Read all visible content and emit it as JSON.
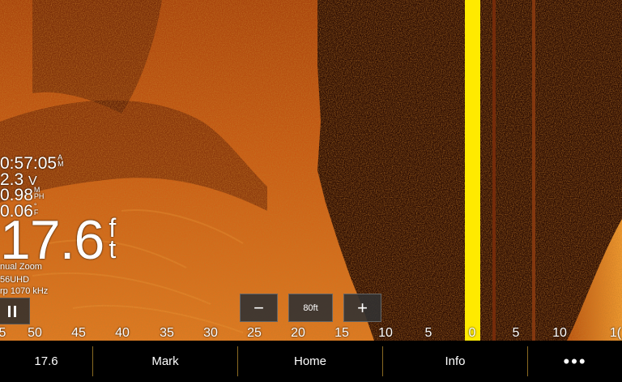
{
  "readouts": {
    "time": "0:57:05",
    "time_suffix_top": "A",
    "time_suffix_bottom": "M",
    "voltage": "2.3",
    "voltage_unit": "V",
    "speed": "0.98",
    "speed_unit_top": "M",
    "speed_unit_bottom": "PH",
    "temperature": "0.06",
    "temperature_unit_top": "°",
    "temperature_unit_bottom": "F",
    "depth": "17.6",
    "depth_unit_top": "f",
    "depth_unit_bottom": "t"
  },
  "status": {
    "zoom_mode": "nual Zoom",
    "transducer": "56UHD",
    "frequency": "rp 1070 kHz"
  },
  "controls": {
    "zoom_out": "−",
    "range": "80ft",
    "zoom_in": "+"
  },
  "scale": [
    "5",
    "50",
    "45",
    "40",
    "35",
    "30",
    "25",
    "20",
    "15",
    "10",
    "5",
    "0",
    "5",
    "10",
    "1("
  ],
  "bottom_bar": {
    "depth": "17.6",
    "mark": "Mark",
    "home": "Home",
    "info": "Info",
    "more": "•••"
  },
  "colors": {
    "sonar_dark": "#2a0c03",
    "sonar_bright": "#e8781e",
    "zero_line": "#ffea00",
    "separator": "#8a6a22"
  }
}
